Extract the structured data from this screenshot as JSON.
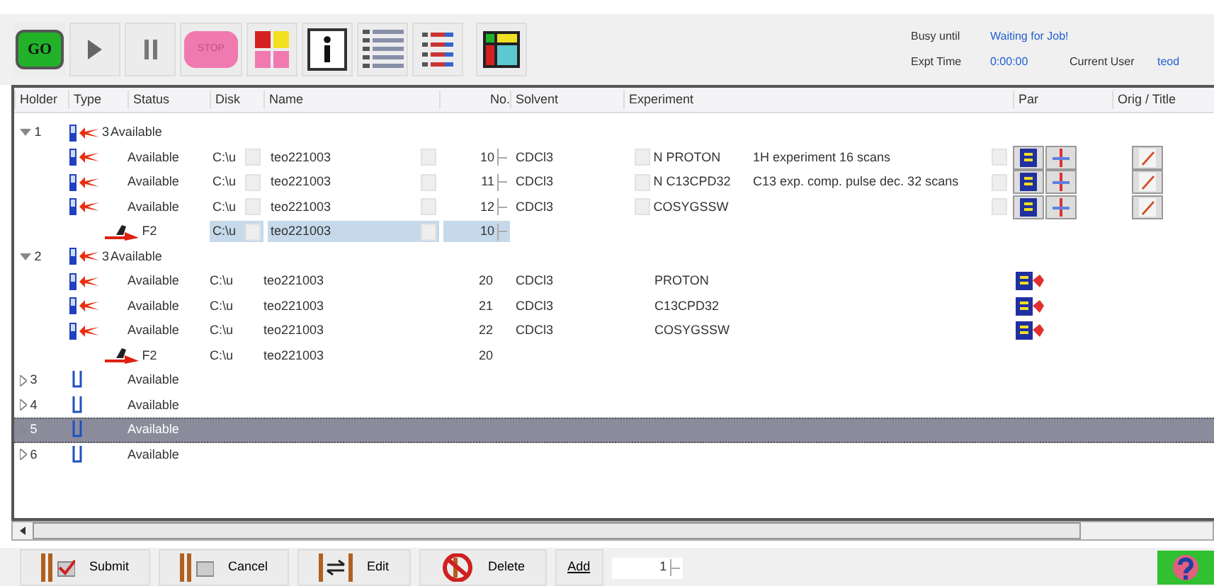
{
  "toolbar": {
    "go_label": "GO",
    "stop_label": "STOP"
  },
  "status": {
    "busy_label": "Busy until",
    "busy_value": "Waiting for Job!",
    "time_label": "Expt Time",
    "time_value": "0:00:00",
    "user_label": "Current User",
    "user_value": "teod"
  },
  "table": {
    "columns": [
      "Holder",
      "Type",
      "Status",
      "Disk",
      "Name",
      "No.",
      "Solvent",
      "Experiment",
      "Par",
      "Orig / Title"
    ],
    "rows": [
      {
        "kind": "holder",
        "number": "1",
        "expanded": true,
        "count": "3",
        "status": "Available",
        "selected": false,
        "children": [
          {
            "kind": "sample",
            "status": "Available",
            "disk": "C:\\u",
            "name": "teo221003",
            "no": "10",
            "solvent": "CDCl3",
            "experiment": "N PROTON",
            "description": "1H experiment 16 scans",
            "editable": true
          },
          {
            "kind": "sample",
            "status": "Available",
            "disk": "C:\\u",
            "name": "teo221003",
            "no": "11",
            "solvent": "CDCl3",
            "experiment": "N C13CPD32",
            "description": "C13 exp. comp. pulse dec. 32 scans",
            "editable": true
          },
          {
            "kind": "sample",
            "status": "Available",
            "disk": "C:\\u",
            "name": "teo221003",
            "no": "12",
            "solvent": "CDCl3",
            "experiment": "COSYGSSW",
            "editable": true
          },
          {
            "kind": "transfer",
            "label": "F2",
            "disk": "C:\\u",
            "name": "teo221003",
            "no": "10",
            "editable": true,
            "highlighted": true
          }
        ]
      },
      {
        "kind": "holder",
        "number": "2",
        "expanded": true,
        "count": "3",
        "status": "Available",
        "selected": false,
        "children": [
          {
            "kind": "sample",
            "status": "Available",
            "disk": "C:\\u",
            "name": "teo221003",
            "no": "20",
            "solvent": "CDCl3",
            "experiment": "PROTON",
            "editable": false
          },
          {
            "kind": "sample",
            "status": "Available",
            "disk": "C:\\u",
            "name": "teo221003",
            "no": "21",
            "solvent": "CDCl3",
            "experiment": "C13CPD32",
            "editable": false
          },
          {
            "kind": "sample",
            "status": "Available",
            "disk": "C:\\u",
            "name": "teo221003",
            "no": "22",
            "solvent": "CDCl3",
            "experiment": "COSYGSSW",
            "editable": false
          },
          {
            "kind": "transfer",
            "label": "F2",
            "disk": "C:\\u",
            "name": "teo221003",
            "no": "20",
            "editable": false,
            "highlighted": false
          }
        ]
      },
      {
        "kind": "holder",
        "number": "3",
        "expanded": false,
        "status": "Available",
        "selected": false
      },
      {
        "kind": "holder",
        "number": "4",
        "expanded": false,
        "status": "Available",
        "selected": false
      },
      {
        "kind": "holder",
        "number": "5",
        "expanded": false,
        "status": "Available",
        "selected": true
      },
      {
        "kind": "holder",
        "number": "6",
        "expanded": false,
        "status": "Available",
        "selected": false
      }
    ]
  },
  "buttons": [
    {
      "kind": "submit",
      "label": "Submit"
    },
    {
      "kind": "cancel",
      "label": "Cancel"
    },
    {
      "kind": "edit",
      "label": "Edit"
    },
    {
      "kind": "delete",
      "label": "Delete"
    }
  ],
  "add": {
    "label": "Add",
    "value": "1"
  }
}
